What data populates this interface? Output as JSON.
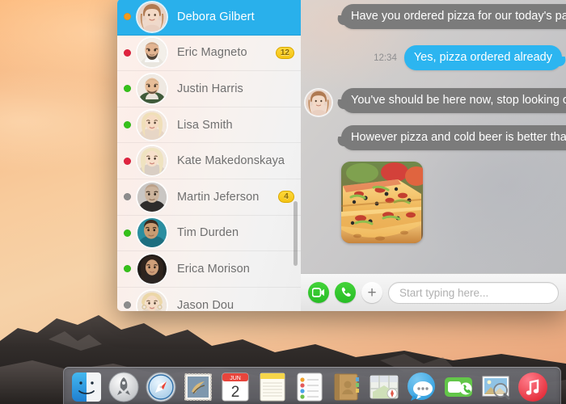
{
  "desktop": {
    "wallpaper_name": "yosemite-sunrise-wallpaper",
    "dock": {
      "items": [
        {
          "name": "finder",
          "label": "Finder"
        },
        {
          "name": "launchpad",
          "label": "Launchpad"
        },
        {
          "name": "safari",
          "label": "Safari"
        },
        {
          "name": "mail",
          "label": "Mail"
        },
        {
          "name": "calendar",
          "label": "Calendar",
          "month": "JUN",
          "day": "2"
        },
        {
          "name": "notes",
          "label": "Notes"
        },
        {
          "name": "reminders",
          "label": "Reminders"
        },
        {
          "name": "contacts",
          "label": "Contacts"
        },
        {
          "name": "maps",
          "label": "Maps"
        },
        {
          "name": "messages",
          "label": "Messages"
        },
        {
          "name": "facetime",
          "label": "FaceTime"
        },
        {
          "name": "preview",
          "label": "Preview"
        },
        {
          "name": "itunes",
          "label": "iTunes"
        }
      ]
    }
  },
  "messenger": {
    "sidebar": {
      "contacts": [
        {
          "name": "Debora Gilbert",
          "status": "away",
          "status_color": "#f39a1a",
          "badge": "",
          "selected": true,
          "avatar": "avatar-debora"
        },
        {
          "name": "Eric Magneto",
          "status": "busy",
          "status_color": "#e0233f",
          "badge": "12",
          "selected": false,
          "avatar": "avatar-eric"
        },
        {
          "name": "Justin Harris",
          "status": "online",
          "status_color": "#35c11a",
          "badge": "",
          "selected": false,
          "avatar": "avatar-justin"
        },
        {
          "name": "Lisa Smith",
          "status": "online",
          "status_color": "#35c11a",
          "badge": "",
          "selected": false,
          "avatar": "avatar-lisa"
        },
        {
          "name": "Kate Makedonskaya",
          "status": "busy",
          "status_color": "#e0233f",
          "badge": "",
          "selected": false,
          "avatar": "avatar-kate"
        },
        {
          "name": "Martin Jeferson",
          "status": "offline",
          "status_color": "#8c8c8c",
          "badge": "4",
          "selected": false,
          "avatar": "avatar-martin"
        },
        {
          "name": "Tim Durden",
          "status": "online",
          "status_color": "#35c11a",
          "badge": "",
          "selected": false,
          "avatar": "avatar-tim"
        },
        {
          "name": "Erica Morison",
          "status": "online",
          "status_color": "#35c11a",
          "badge": "",
          "selected": false,
          "avatar": "avatar-erica"
        },
        {
          "name": "Jason Dou",
          "status": "offline",
          "status_color": "#8c8c8c",
          "badge": "",
          "selected": false,
          "avatar": "avatar-jason"
        }
      ],
      "scrollbar_visible": true
    },
    "conversation": {
      "messages": [
        {
          "id": "m1",
          "direction": "incoming",
          "type": "text",
          "text": "Have you ordered pizza for our today's party?",
          "time": "",
          "show_avatar": false
        },
        {
          "id": "m2",
          "direction": "outgoing",
          "type": "text",
          "text": "Yes, pizza ordered already",
          "time": "12:34",
          "show_avatar": false
        },
        {
          "id": "m3",
          "direction": "incoming",
          "type": "text",
          "text": "You've should be here now, stop looking on your phone",
          "time": "",
          "show_avatar": true
        },
        {
          "id": "m4",
          "direction": "incoming",
          "type": "text",
          "text": "However pizza and cold beer is better than nothing",
          "time": "",
          "show_avatar": false
        },
        {
          "id": "m5",
          "direction": "incoming",
          "type": "image",
          "text": "",
          "alt": "pizza-photo",
          "time": "",
          "show_avatar": false
        }
      ]
    },
    "composer": {
      "video_call_label": "Video call",
      "audio_call_label": "Audio call",
      "attach_label": "+",
      "input_placeholder": "Start typing here...",
      "input_value": ""
    },
    "colors": {
      "selection_blue": "#29b0eb",
      "outgoing_bubble": "#2cb5f0",
      "incoming_bubble": "#7b7b7b",
      "badge_yellow": "#f4c413",
      "call_button_green": "#2bc327"
    }
  }
}
